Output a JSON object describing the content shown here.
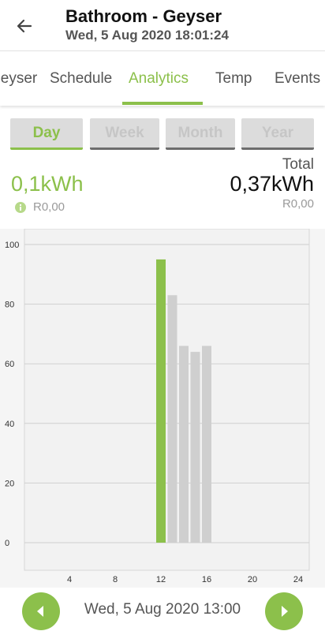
{
  "header": {
    "title": "Bathroom - Geyser",
    "subtitle": "Wed, 5 Aug 2020 18:01:24",
    "back_icon": "arrow-left-icon"
  },
  "tabs": [
    {
      "label": "Geyser",
      "active": false
    },
    {
      "label": "Schedule",
      "active": false
    },
    {
      "label": "Analytics",
      "active": true
    },
    {
      "label": "Temp",
      "active": false
    },
    {
      "label": "Events",
      "active": false
    }
  ],
  "periods": [
    {
      "label": "Day",
      "active": true
    },
    {
      "label": "Week",
      "active": false
    },
    {
      "label": "Month",
      "active": false
    },
    {
      "label": "Year",
      "active": false
    }
  ],
  "usage": {
    "value": "0,1kWh",
    "cost": "R0,00",
    "icon": "info-icon"
  },
  "total": {
    "label": "Total",
    "value": "0,37kWh",
    "cost": "R0,00"
  },
  "colors": {
    "accent": "#8cc04b",
    "bar_inactive": "#cfcfcf"
  },
  "chart_data": {
    "type": "bar",
    "x": [
      12,
      13,
      14,
      15,
      16
    ],
    "values": [
      95,
      83,
      66,
      64,
      66
    ],
    "selected_index": 0,
    "xlim": [
      0,
      24
    ],
    "ylim": [
      0,
      100
    ],
    "xticks": [
      4,
      8,
      12,
      16,
      20,
      24
    ],
    "yticks": [
      0,
      20,
      40,
      60,
      80,
      100
    ],
    "grid": true
  },
  "footer": {
    "date": "Wed, 5 Aug 2020 13:00",
    "prev_icon": "chevron-left-icon",
    "next_icon": "chevron-right-icon"
  }
}
